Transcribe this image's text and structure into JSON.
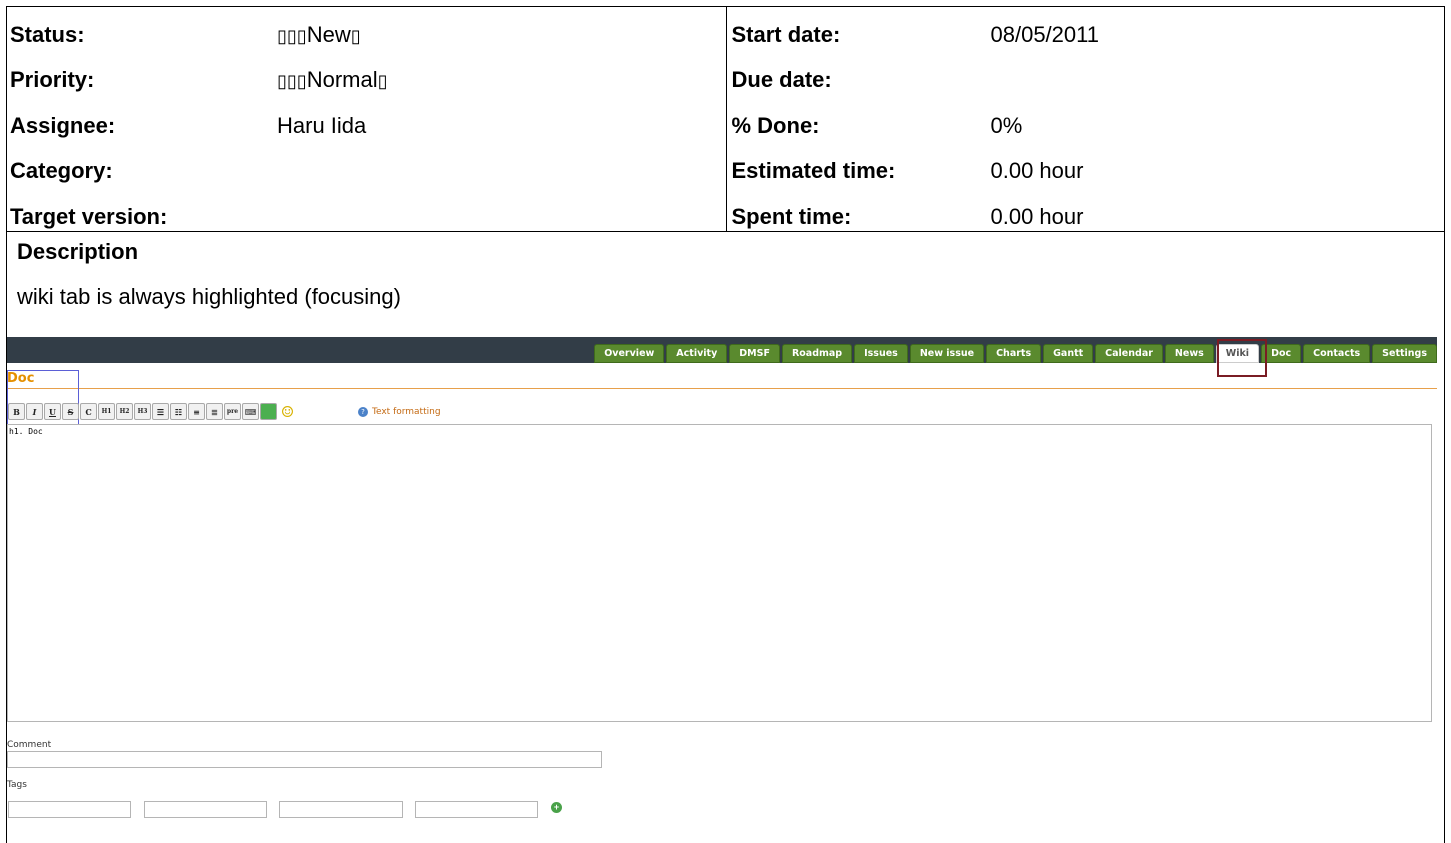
{
  "attributes": {
    "left": [
      {
        "label": "Status:",
        "value_glyphs": "▯▯▯",
        "value": "New",
        "value_suffix": "▯"
      },
      {
        "label": "Priority:",
        "value_glyphs": "▯▯▯",
        "value": "Normal",
        "value_suffix": "▯"
      },
      {
        "label": "Assignee:",
        "value_glyphs": "",
        "value": "Haru Iida",
        "value_suffix": ""
      },
      {
        "label": "Category:",
        "value_glyphs": "",
        "value": "",
        "value_suffix": ""
      },
      {
        "label": "Target version:",
        "value_glyphs": "",
        "value": "",
        "value_suffix": ""
      }
    ],
    "right": [
      {
        "label": "Start date:",
        "value": "08/05/2011"
      },
      {
        "label": "Due date:",
        "value": ""
      },
      {
        "label": "% Done:",
        "value": "0%"
      },
      {
        "label": "Estimated time:",
        "value": "0.00 hour"
      },
      {
        "label": "Spent time:",
        "value": "0.00 hour"
      }
    ]
  },
  "description": {
    "title": "Description",
    "text": "wiki tab is always highlighted (focusing)"
  },
  "screenshot": {
    "tabs": [
      "Overview",
      "Activity",
      "DMSF",
      "Roadmap",
      "Issues",
      "New issue",
      "Charts",
      "Gantt",
      "Calendar",
      "News",
      "Wiki",
      "Doc",
      "Contacts",
      "Settings"
    ],
    "selected_tab": "Wiki",
    "page_heading": "Doc",
    "toolbar": [
      "B",
      "I",
      "U",
      "S",
      "C",
      "H1",
      "H2",
      "H3",
      "ul",
      "ol",
      "bq",
      "unbq",
      "pre",
      "link",
      "img",
      "smiley"
    ],
    "help_link": "Text formatting",
    "editor_text": "h1. Doc",
    "comment_label": "Comment",
    "tags_label": "Tags",
    "colors": {
      "tab_green": "#5a8a2e",
      "topbar": "#323d47",
      "heading": "#e59000",
      "highlight": "#7a1c24"
    }
  }
}
